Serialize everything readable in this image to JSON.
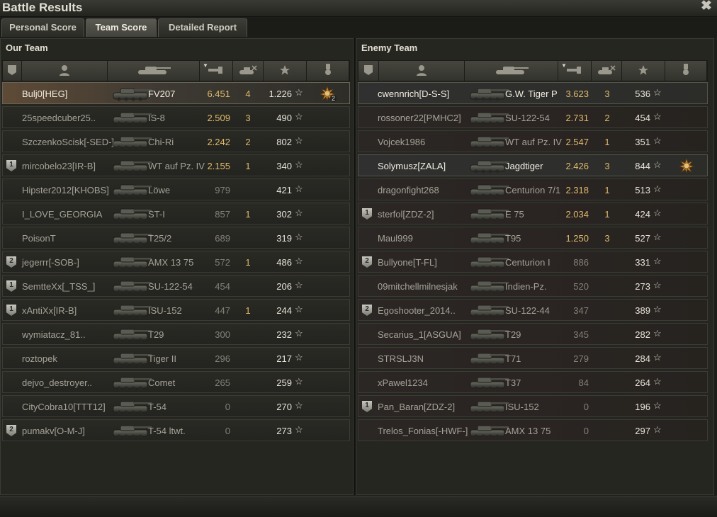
{
  "window": {
    "title": "Battle Results",
    "close_glyph": "✖"
  },
  "tabs": [
    {
      "label": "Personal Score",
      "active": false
    },
    {
      "label": "Team Score",
      "active": true
    },
    {
      "label": "Detailed Report",
      "active": false
    }
  ],
  "icons": {
    "platoon": "platoon-shield-icon",
    "player": "player-icon",
    "vehicle": "tank-icon",
    "damage": "damage-icon",
    "kills": "kills-tank-icon",
    "xp": "star-icon",
    "medals": "medal-icon",
    "star_glyph": "☆"
  },
  "colors": {
    "gold_value": "#dfba6a",
    "highlight_row": "#5e4a36",
    "enemy_row_tint": "#2a2422"
  },
  "our_team": {
    "title": "Our Team",
    "sorted_column": "damage",
    "rows": [
      {
        "platoon": "",
        "player": "Bulj0[HEG]",
        "vehicle": "FV207",
        "damage": "6.451",
        "kills": "4",
        "xp": "1.226",
        "medal": "yes",
        "medal_count": "2",
        "highlight": true
      },
      {
        "platoon": "",
        "player": "25speedcuber25..",
        "vehicle": "IS-8",
        "damage": "2.509",
        "kills": "3",
        "xp": "490",
        "medal": "",
        "medal_count": "",
        "highlight": false
      },
      {
        "platoon": "",
        "player": "SzczenkoScisk[-SED-]",
        "vehicle": "Chi-Ri",
        "damage": "2.242",
        "kills": "2",
        "xp": "802",
        "medal": "",
        "medal_count": "",
        "highlight": false
      },
      {
        "platoon": "1",
        "player": "mircobelo23[IR-B]",
        "vehicle": "WT auf Pz. IV",
        "damage": "2.155",
        "kills": "1",
        "xp": "340",
        "medal": "",
        "medal_count": "",
        "highlight": false
      },
      {
        "platoon": "",
        "player": "Hipster2012[KHOBS]",
        "vehicle": "Löwe",
        "damage": "979",
        "kills": "",
        "xp": "421",
        "medal": "",
        "medal_count": "",
        "highlight": false
      },
      {
        "platoon": "",
        "player": "I_LOVE_GEORGIA",
        "vehicle": "ST-I",
        "damage": "857",
        "kills": "1",
        "xp": "302",
        "medal": "",
        "medal_count": "",
        "highlight": false
      },
      {
        "platoon": "",
        "player": "PoisonT",
        "vehicle": "T25/2",
        "damage": "689",
        "kills": "",
        "xp": "319",
        "medal": "",
        "medal_count": "",
        "highlight": false
      },
      {
        "platoon": "2",
        "player": "jegerrr[-SOB-]",
        "vehicle": "AMX 13 75",
        "damage": "572",
        "kills": "1",
        "xp": "486",
        "medal": "",
        "medal_count": "",
        "highlight": false
      },
      {
        "platoon": "1",
        "player": "SemtteXx[_TSS_]",
        "vehicle": "SU-122-54",
        "damage": "454",
        "kills": "",
        "xp": "206",
        "medal": "",
        "medal_count": "",
        "highlight": false
      },
      {
        "platoon": "1",
        "player": "xAntiXx[IR-B]",
        "vehicle": "ISU-152",
        "damage": "447",
        "kills": "1",
        "xp": "244",
        "medal": "",
        "medal_count": "",
        "highlight": false
      },
      {
        "platoon": "",
        "player": "wymiatacz_81..",
        "vehicle": "T29",
        "damage": "300",
        "kills": "",
        "xp": "232",
        "medal": "",
        "medal_count": "",
        "highlight": false
      },
      {
        "platoon": "",
        "player": "roztopek",
        "vehicle": "Tiger II",
        "damage": "296",
        "kills": "",
        "xp": "217",
        "medal": "",
        "medal_count": "",
        "highlight": false
      },
      {
        "platoon": "",
        "player": "dejvo_destroyer..",
        "vehicle": "Comet",
        "damage": "265",
        "kills": "",
        "xp": "259",
        "medal": "",
        "medal_count": "",
        "highlight": false
      },
      {
        "platoon": "",
        "player": "CityCobra10[TTT12]",
        "vehicle": "T-54",
        "damage": "0",
        "kills": "",
        "xp": "270",
        "medal": "",
        "medal_count": "",
        "highlight": false
      },
      {
        "platoon": "2",
        "player": "pumakv[O-M-J]",
        "vehicle": "T-54 ltwt.",
        "damage": "0",
        "kills": "",
        "xp": "273",
        "medal": "",
        "medal_count": "",
        "highlight": false
      }
    ]
  },
  "enemy_team": {
    "title": "Enemy Team",
    "sorted_column": "damage",
    "rows": [
      {
        "platoon": "",
        "player": "cwennrich[D-S-S]",
        "vehicle": "G.W. Tiger P",
        "damage": "3.623",
        "kills": "3",
        "xp": "536",
        "medal": "",
        "medal_count": "",
        "highlight": true
      },
      {
        "platoon": "",
        "player": "rossoner22[PMHC2]",
        "vehicle": "SU-122-54",
        "damage": "2.731",
        "kills": "2",
        "xp": "454",
        "medal": "",
        "medal_count": "",
        "highlight": false
      },
      {
        "platoon": "",
        "player": "Vojcek1986",
        "vehicle": "WT auf Pz. IV",
        "damage": "2.547",
        "kills": "1",
        "xp": "351",
        "medal": "",
        "medal_count": "",
        "highlight": false
      },
      {
        "platoon": "",
        "player": "Solymusz[ZALA]",
        "vehicle": "Jagdtiger",
        "damage": "2.426",
        "kills": "3",
        "xp": "844",
        "medal": "yes",
        "medal_count": "",
        "highlight": true
      },
      {
        "platoon": "",
        "player": "dragonfight268",
        "vehicle": "Centurion 7/1",
        "damage": "2.318",
        "kills": "1",
        "xp": "513",
        "medal": "",
        "medal_count": "",
        "highlight": false
      },
      {
        "platoon": "1",
        "player": "sterfol[ZDZ-2]",
        "vehicle": "E 75",
        "damage": "2.034",
        "kills": "1",
        "xp": "424",
        "medal": "",
        "medal_count": "",
        "highlight": false
      },
      {
        "platoon": "",
        "player": "Maul999",
        "vehicle": "T95",
        "damage": "1.250",
        "kills": "3",
        "xp": "527",
        "medal": "",
        "medal_count": "",
        "highlight": false
      },
      {
        "platoon": "2",
        "player": "Bullyone[T-FL]",
        "vehicle": "Centurion I",
        "damage": "886",
        "kills": "",
        "xp": "331",
        "medal": "",
        "medal_count": "",
        "highlight": false
      },
      {
        "platoon": "",
        "player": "09mitchellmilnesjak",
        "vehicle": "Indien-Pz.",
        "damage": "520",
        "kills": "",
        "xp": "273",
        "medal": "",
        "medal_count": "",
        "highlight": false
      },
      {
        "platoon": "2",
        "player": "Egoshooter_2014..",
        "vehicle": "SU-122-44",
        "damage": "347",
        "kills": "",
        "xp": "389",
        "medal": "",
        "medal_count": "",
        "highlight": false
      },
      {
        "platoon": "",
        "player": "Secarius_1[ASGUA]",
        "vehicle": "T29",
        "damage": "345",
        "kills": "",
        "xp": "282",
        "medal": "",
        "medal_count": "",
        "highlight": false
      },
      {
        "platoon": "",
        "player": "STRSLJ3N",
        "vehicle": "T71",
        "damage": "279",
        "kills": "",
        "xp": "284",
        "medal": "",
        "medal_count": "",
        "highlight": false
      },
      {
        "platoon": "",
        "player": "xPawel1234",
        "vehicle": "T37",
        "damage": "84",
        "kills": "",
        "xp": "264",
        "medal": "",
        "medal_count": "",
        "highlight": false
      },
      {
        "platoon": "1",
        "player": "Pan_Baran[ZDZ-2]",
        "vehicle": "ISU-152",
        "damage": "0",
        "kills": "",
        "xp": "196",
        "medal": "",
        "medal_count": "",
        "highlight": false
      },
      {
        "platoon": "",
        "player": "Trelos_Fonias[-HWF-]",
        "vehicle": "AMX 13 75",
        "damage": "0",
        "kills": "",
        "xp": "297",
        "medal": "",
        "medal_count": "",
        "highlight": false
      }
    ]
  }
}
